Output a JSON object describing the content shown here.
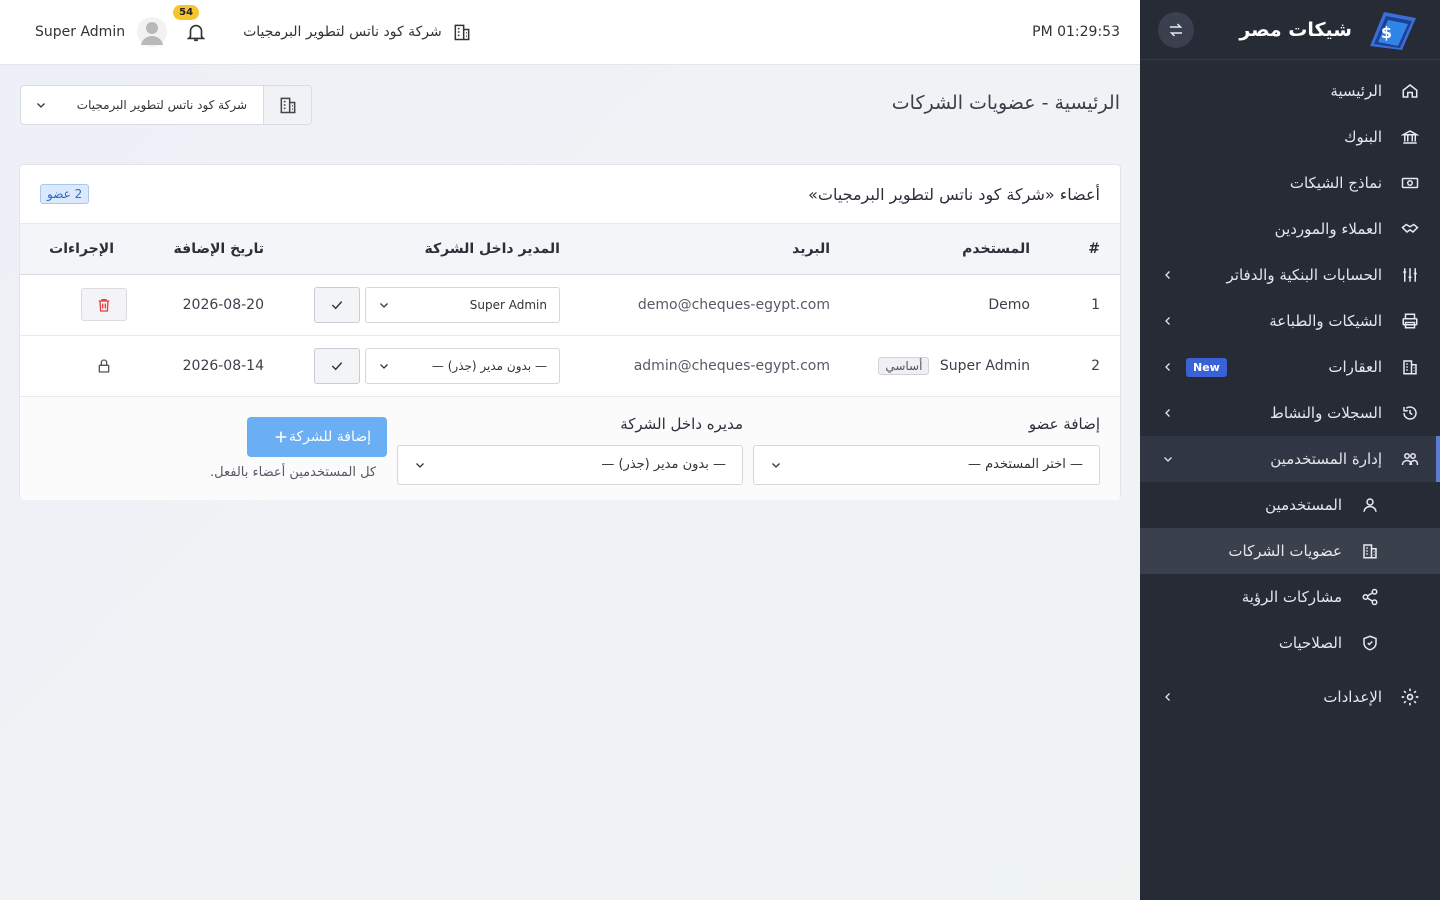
{
  "app": {
    "title": "شيكات مصر",
    "logo_name": "cheques-logo"
  },
  "topbar": {
    "time": "PM 01:29:53",
    "company": "شركة كود ناتس لتطوير البرمجيات",
    "notifications": "54",
    "user": "Super Admin"
  },
  "sidebar": {
    "items": [
      {
        "label": "الرئيسية",
        "icon": "home-icon"
      },
      {
        "label": "البنوك",
        "icon": "bank-icon"
      },
      {
        "label": "نماذج الشيكات",
        "icon": "banknote-icon"
      },
      {
        "label": "العملاء والموردين",
        "icon": "handshake-icon"
      },
      {
        "label": "الحسابات البنكية والدفاتر",
        "icon": "sliders-icon"
      },
      {
        "label": "الشيكات والطباعة",
        "icon": "printer-icon"
      },
      {
        "label": "العقارات",
        "icon": "building-icon",
        "badge": "New"
      },
      {
        "label": "السجلات والنشاط",
        "icon": "history-icon"
      },
      {
        "label": "إدارة المستخدمين",
        "icon": "users-icon"
      },
      {
        "label": "الإعدادات",
        "icon": "gear-icon"
      }
    ],
    "sub": [
      {
        "label": "المستخدمين",
        "icon": "user-icon"
      },
      {
        "label": "عضويات الشركات",
        "icon": "building-icon"
      },
      {
        "label": "مشاركات الرؤية",
        "icon": "share-icon"
      },
      {
        "label": "الصلاحيات",
        "icon": "shield-icon"
      }
    ]
  },
  "page": {
    "title": "الرئيسية - عضويات الشركات",
    "company_select": "شركة كود ناتس لتطوير البرمجيات"
  },
  "card": {
    "title": "أعضاء «شركة كود ناتس لتطوير البرمجيات»",
    "count": "2 عضو",
    "columns": [
      "#",
      "المستخدم",
      "البريد",
      "المدير داخل الشركة",
      "تاريخ الإضافة",
      "الإجراءات"
    ],
    "rows": [
      {
        "num": "1",
        "user": "Demo",
        "email": "demo@cheques-egypt.com",
        "manager": "Super Admin",
        "date": "2026-08-20",
        "tag": ""
      },
      {
        "num": "2",
        "user": "Super Admin",
        "email": "admin@cheques-egypt.com",
        "manager": "— بدون مدير (جذر) —",
        "date": "2026-08-14",
        "tag": "أساسي"
      }
    ],
    "add": {
      "member_label": "إضافة عضو",
      "manager_label": "مديره داخل الشركة",
      "user_placeholder": "— اختر المستخدم —",
      "manager_value": "— بدون مدير (جذر) —",
      "button": "إضافة للشركة",
      "hint": "كل المستخدمين أعضاء بالفعل."
    }
  },
  "colors": {
    "sidebar_bg": "#262b36",
    "accent": "#5a7bd6",
    "add_button": "#6aaef3",
    "danger": "#e53e3e",
    "badge_new": "#3a62d6"
  }
}
